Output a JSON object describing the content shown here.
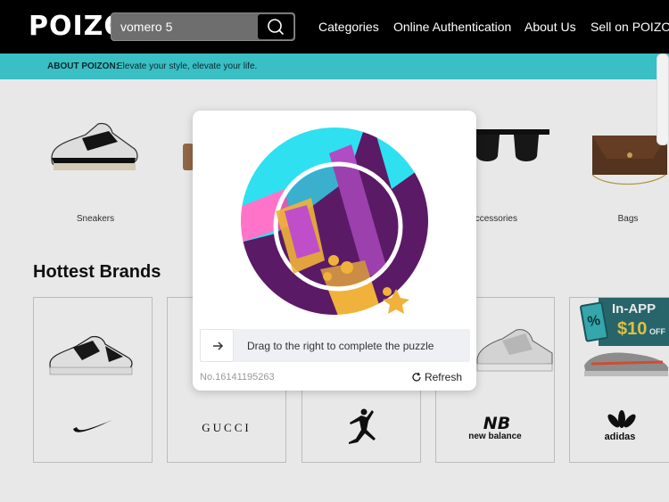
{
  "header": {
    "logo": "POIZON",
    "search": {
      "value": "vomero 5",
      "placeholder": ""
    },
    "nav": [
      "Categories",
      "Online Authentication",
      "About Us",
      "Sell on POIZON"
    ]
  },
  "about_bar": {
    "label": "ABOUT POIZON:",
    "text": "Elevate your style, elevate your life."
  },
  "categories": [
    "Sneakers",
    "Accessories",
    "Bags"
  ],
  "hottest_brands": {
    "title": "Hottest Brands",
    "brands": [
      "GUCCI",
      "new balance",
      "adidas"
    ],
    "promo": {
      "title": "In-APP",
      "amount": "$10",
      "suffix": "OFF"
    }
  },
  "captcha": {
    "instruction": "Drag to the right to complete the puzzle",
    "serial": "No.16141195263",
    "refresh_label": "Refresh"
  },
  "colors": {
    "teal": "#39bfc4",
    "puzzle_purple": "#5b1a66",
    "puzzle_cyan": "#2fe0f0"
  }
}
